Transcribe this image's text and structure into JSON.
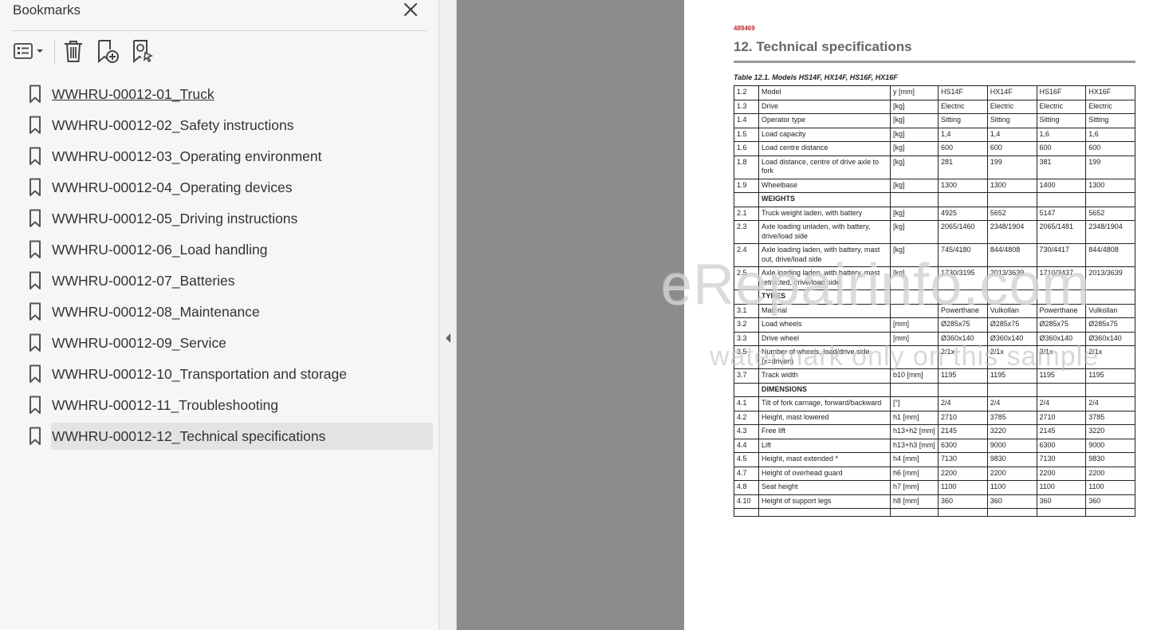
{
  "bookmarks_panel": {
    "title": "Bookmarks",
    "toolbar": {
      "options_icon": "list-options-icon",
      "delete_icon": "trash-icon",
      "new_bookmark_icon": "new-bookmark-icon",
      "find_bookmark_icon": "find-bookmark-icon"
    },
    "items": [
      {
        "label": "WWHRU-00012-01_Truck"
      },
      {
        "label": "WWHRU-00012-02_Safety instructions"
      },
      {
        "label": "WWHRU-00012-03_Operating environment"
      },
      {
        "label": "WWHRU-00012-04_Operating devices"
      },
      {
        "label": "WWHRU-00012-05_Driving instructions"
      },
      {
        "label": "WWHRU-00012-06_Load handling"
      },
      {
        "label": "WWHRU-00012-07_Batteries"
      },
      {
        "label": "WWHRU-00012-08_Maintenance"
      },
      {
        "label": "WWHRU-00012-09_Service"
      },
      {
        "label": "WWHRU-00012-10_Transportation and storage"
      },
      {
        "label": "WWHRU-00012-11_Troubleshooting"
      },
      {
        "label": "WWHRU-00012-12_Technical specifications"
      }
    ],
    "selected_index": 11,
    "hovered_index": 0
  },
  "document": {
    "code": "489469",
    "heading": "12. Technical specifications",
    "table_caption": "Table 12.1. Models HS14F, HX14F, HS16F, HX16F",
    "rows": [
      {
        "no": "1.2",
        "desc": "Model",
        "unit": "y [mm]",
        "v": [
          "HS14F",
          "HX14F",
          "HS16F",
          "HX16F"
        ]
      },
      {
        "no": "1.3",
        "desc": "Drive",
        "unit": "[kg]",
        "v": [
          "Electric",
          "Electric",
          "Electric",
          "Electric"
        ]
      },
      {
        "no": "1.4",
        "desc": "Operator type",
        "unit": "[kg]",
        "v": [
          "Sitting",
          "Sitting",
          "Sitting",
          "Sitting"
        ]
      },
      {
        "no": "1.5",
        "desc": "Load capacity",
        "unit": "[kg]",
        "v": [
          "1,4",
          "1,4",
          "1,6",
          "1,6"
        ]
      },
      {
        "no": "1.6",
        "desc": "Load centre distance",
        "unit": "[kg]",
        "v": [
          "600",
          "600",
          "600",
          "600"
        ]
      },
      {
        "no": "1.8",
        "desc": "Load distance, centre of drive axle to fork",
        "unit": "[kg]",
        "v": [
          "281",
          "199",
          "381",
          "199"
        ]
      },
      {
        "no": "1.9",
        "desc": "Wheelbase",
        "unit": "[kg]",
        "v": [
          "1300",
          "1300",
          "1400",
          "1300"
        ]
      },
      {
        "section": "WEIGHTS"
      },
      {
        "no": "2.1",
        "desc": "Truck weight laden, with battery",
        "unit": "[kg]",
        "v": [
          "4925",
          "5652",
          "5147",
          "5652"
        ]
      },
      {
        "no": "2.3",
        "desc": "Axle loading unladen, with battery, drive/load side",
        "unit": "[kg]",
        "v": [
          "2065/1460",
          "2348/1904",
          "2065/1481",
          "2348/1904"
        ]
      },
      {
        "no": "2.4",
        "desc": "Axle loading laden, with battery, mast out, drive/load side",
        "unit": "[kg]",
        "v": [
          "745/4180",
          "844/4808",
          "730/4417",
          "844/4808"
        ]
      },
      {
        "no": "2.5",
        "desc": "Axle loading laden, with battery, mast retracted, drive/load side",
        "unit": "[kg]",
        "v": [
          "1730/3195",
          "2013/3639",
          "1710/3437",
          "2013/3639"
        ]
      },
      {
        "section": "TYRES"
      },
      {
        "no": "3.1",
        "desc": "Material",
        "unit": "",
        "v": [
          "Powerthane",
          "Vulkollan",
          "Powerthane",
          "Vulkollan"
        ]
      },
      {
        "no": "3.2",
        "desc": "Load wheels",
        "unit": "[mm]",
        "v": [
          "Ø285x75",
          "Ø285x75",
          "Ø285x75",
          "Ø285x75"
        ]
      },
      {
        "no": "3.3",
        "desc": "Drive wheel",
        "unit": "[mm]",
        "v": [
          "Ø360x140",
          "Ø360x140",
          "Ø360x140",
          "Ø360x140"
        ]
      },
      {
        "no": "3.5",
        "desc": "Number of wheels, load/drive side (x=driven)",
        "unit": "",
        "v": [
          "2/1x",
          "2/1x",
          "2/1x",
          "2/1x"
        ]
      },
      {
        "no": "3.7",
        "desc": "Track width",
        "unit": "b10 [mm]",
        "v": [
          "1195",
          "1195",
          "1195",
          "1195"
        ]
      },
      {
        "section": "DIMENSIONS"
      },
      {
        "no": "4.1",
        "desc": "Tilt of fork carriage, forward/backward",
        "unit": "[°]",
        "v": [
          "2/4",
          "2/4",
          "2/4",
          "2/4"
        ]
      },
      {
        "no": "4.2",
        "desc": "Height, mast lowered",
        "unit": "h1 [mm]",
        "v": [
          "2710",
          "3785",
          "2710",
          "3785"
        ]
      },
      {
        "no": "4.3",
        "desc": "Free lift",
        "unit": "h13+h2 [mm]",
        "v": [
          "2145",
          "3220",
          "2145",
          "3220"
        ]
      },
      {
        "no": "4.4",
        "desc": "Lift",
        "unit": "h13+h3 [mm]",
        "v": [
          "6300",
          "9000",
          "6300",
          "9000"
        ]
      },
      {
        "no": "4.5",
        "desc": "Height, mast extended *",
        "unit": "h4 [mm]",
        "v": [
          "7130",
          "9830",
          "7130",
          "9830"
        ]
      },
      {
        "no": "4.7",
        "desc": "Height of overhead guard",
        "unit": "h6 [mm]",
        "v": [
          "2200",
          "2200",
          "2200",
          "2200"
        ]
      },
      {
        "no": "4.8",
        "desc": "Seat height",
        "unit": "h7 [mm]",
        "v": [
          "1100",
          "1100",
          "1100",
          "1100"
        ]
      },
      {
        "no": "4.10",
        "desc": "Height of support legs",
        "unit": "h8 [mm]",
        "v": [
          "360",
          "360",
          "360",
          "360"
        ]
      },
      {
        "no": "",
        "desc": "",
        "unit": "",
        "v": [
          "",
          "",
          "",
          ""
        ]
      }
    ]
  },
  "watermark": {
    "main": "eRepairinfo.com",
    "sub": "watermark only on this sample"
  },
  "colors": {
    "panel_bg": "#f6f6f6",
    "gray_area": "#8c8c8c",
    "doc_code_red": "#c0272d",
    "selected_bg": "#e3e3e3"
  }
}
